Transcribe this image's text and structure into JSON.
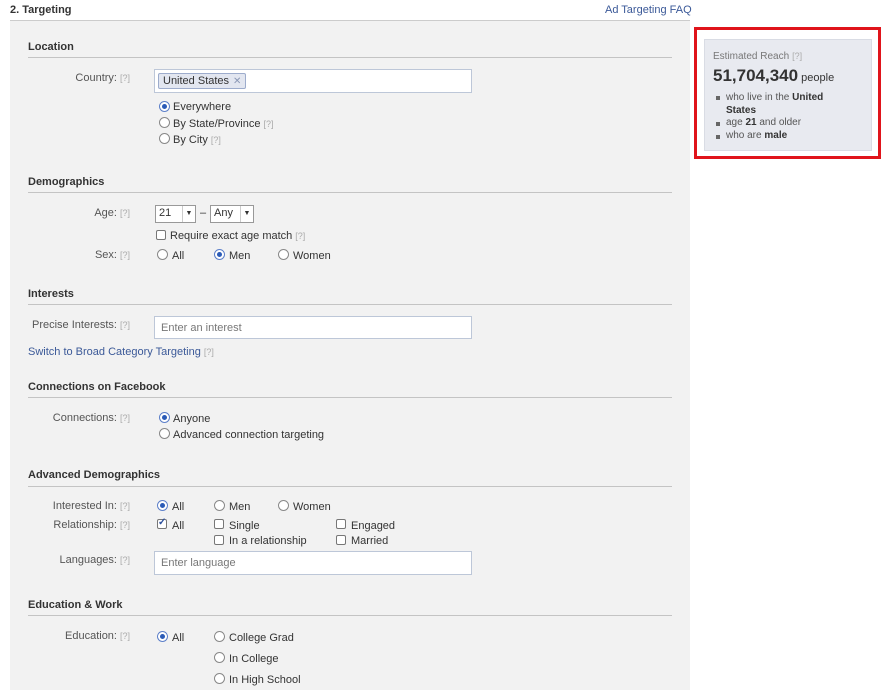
{
  "header": {
    "title": "2. Targeting",
    "faq_link": "Ad Targeting FAQ"
  },
  "help_marker": "[?]",
  "location": {
    "title": "Location",
    "country_label": "Country:",
    "country_token": "United States",
    "options": [
      "Everywhere",
      "By State/Province",
      "By City"
    ],
    "selected": "Everywhere"
  },
  "demographics": {
    "title": "Demographics",
    "age_label": "Age:",
    "age_min": "21",
    "age_sep": "–",
    "age_max": "Any",
    "exact_match_label": "Require exact age match",
    "sex_label": "Sex:",
    "sex_options": [
      "All",
      "Men",
      "Women"
    ],
    "sex_selected": "Men"
  },
  "interests": {
    "title": "Interests",
    "precise_label": "Precise Interests:",
    "placeholder": "Enter an interest",
    "switch_link": "Switch to Broad Category Targeting"
  },
  "connections": {
    "title": "Connections on Facebook",
    "label": "Connections:",
    "options": [
      "Anyone",
      "Advanced connection targeting"
    ],
    "selected": "Anyone"
  },
  "advanced": {
    "title": "Advanced Demographics",
    "interested_label": "Interested In:",
    "interested_options": [
      "All",
      "Men",
      "Women"
    ],
    "interested_selected": "All",
    "relationship_label": "Relationship:",
    "relationship_options": [
      "All",
      "Single",
      "Engaged",
      "In a relationship",
      "Married"
    ],
    "relationship_checked": [
      "All"
    ],
    "languages_label": "Languages:",
    "languages_placeholder": "Enter language"
  },
  "education": {
    "title": "Education & Work",
    "label": "Education:",
    "options": [
      "All",
      "College Grad",
      "In College",
      "In High School"
    ],
    "selected": "All"
  },
  "reach": {
    "title": "Estimated Reach",
    "count": "51,704,340",
    "unit": "people",
    "line1_pre": "who live in the",
    "line1_bold_a": "United",
    "line1_bold_b": "States",
    "line2_pre": "age",
    "line2_bold": "21",
    "line2_post": "and older",
    "line3_pre": "who are",
    "line3_bold": "male",
    "highlight_color": "#e0141b"
  }
}
